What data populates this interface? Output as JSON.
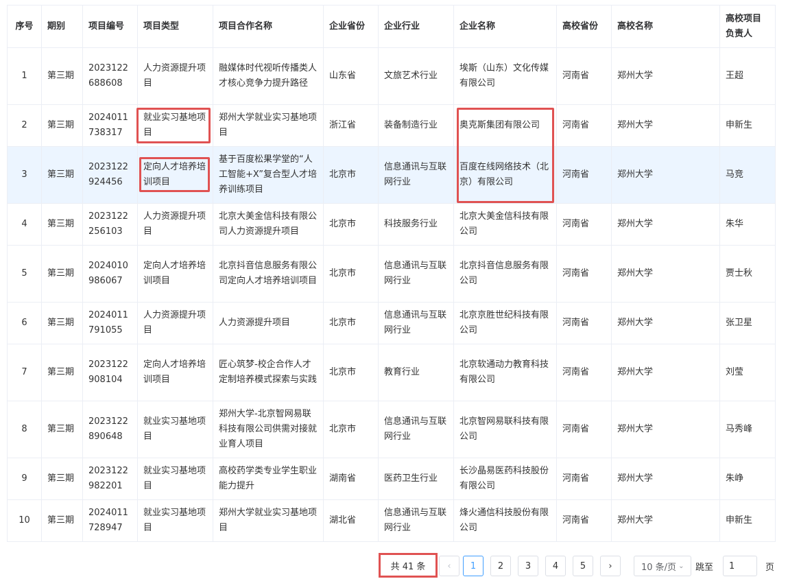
{
  "columns": [
    "序号",
    "期别",
    "项目编号",
    "项目类型",
    "项目合作名称",
    "企业省份",
    "企业行业",
    "企业名称",
    "高校省份",
    "高校名称",
    "高校项目负责人"
  ],
  "rows": [
    {
      "no": "1",
      "period": "第三期",
      "code": "2023122688608",
      "type": "人力资源提升项目",
      "name": "融媒体时代视听传播类人才核心竞争力提升路径",
      "prov": "山东省",
      "industry": "文旅艺术行业",
      "company": "埃斯（山东）文化传媒有限公司",
      "uprov": "河南省",
      "uni": "郑州大学",
      "lead": "王超"
    },
    {
      "no": "2",
      "period": "第三期",
      "code": "2024011738317",
      "type": "就业实习基地项目",
      "name": "郑州大学就业实习基地项目",
      "prov": "浙江省",
      "industry": "装备制造行业",
      "company": "奥克斯集团有限公司",
      "uprov": "河南省",
      "uni": "郑州大学",
      "lead": "申新生"
    },
    {
      "no": "3",
      "period": "第三期",
      "code": "2023122924456",
      "type": "定向人才培养培训项目",
      "name": "基于百度松果学堂的“人工智能+X”复合型人才培养训练项目",
      "prov": "北京市",
      "industry": "信息通讯与互联网行业",
      "company": "百度在线网络技术（北京）有限公司",
      "uprov": "河南省",
      "uni": "郑州大学",
      "lead": "马竞"
    },
    {
      "no": "4",
      "period": "第三期",
      "code": "2023122256103",
      "type": "人力资源提升项目",
      "name": "北京大美金信科技有限公司人力资源提升项目",
      "prov": "北京市",
      "industry": "科技服务行业",
      "company": "北京大美金信科技有限公司",
      "uprov": "河南省",
      "uni": "郑州大学",
      "lead": "朱华"
    },
    {
      "no": "5",
      "period": "第三期",
      "code": "2024010986067",
      "type": "定向人才培养培训项目",
      "name": "北京抖音信息服务有限公司定向人才培养培训项目",
      "prov": "北京市",
      "industry": "信息通讯与互联网行业",
      "company": "北京抖音信息服务有限公司",
      "uprov": "河南省",
      "uni": "郑州大学",
      "lead": "贾士秋"
    },
    {
      "no": "6",
      "period": "第三期",
      "code": "2024011791055",
      "type": "人力资源提升项目",
      "name": "人力资源提升项目",
      "prov": "北京市",
      "industry": "信息通讯与互联网行业",
      "company": "北京京胜世纪科技有限公司",
      "uprov": "河南省",
      "uni": "郑州大学",
      "lead": "张卫星"
    },
    {
      "no": "7",
      "period": "第三期",
      "code": "2023122908104",
      "type": "定向人才培养培训项目",
      "name": "匠心筑梦-校企合作人才定制培养模式探索与实践",
      "prov": "北京市",
      "industry": "教育行业",
      "company": "北京软通动力教育科技有限公司",
      "uprov": "河南省",
      "uni": "郑州大学",
      "lead": "刘莹"
    },
    {
      "no": "8",
      "period": "第三期",
      "code": "2023122890648",
      "type": "就业实习基地项目",
      "name": "郑州大学-北京智网易联科技有限公司供需对接就业育人项目",
      "prov": "北京市",
      "industry": "信息通讯与互联网行业",
      "company": "北京智网易联科技有限公司",
      "uprov": "河南省",
      "uni": "郑州大学",
      "lead": "马秀峰"
    },
    {
      "no": "9",
      "period": "第三期",
      "code": "2023122982201",
      "type": "就业实习基地项目",
      "name": "高校药学类专业学生职业能力提升",
      "prov": "湖南省",
      "industry": "医药卫生行业",
      "company": "长沙晶易医药科技股份有限公司",
      "uprov": "河南省",
      "uni": "郑州大学",
      "lead": "朱峥"
    },
    {
      "no": "10",
      "period": "第三期",
      "code": "2024011728947",
      "type": "就业实习基地项目",
      "name": "郑州大学就业实习基地项目",
      "prov": "湖北省",
      "industry": "信息通讯与互联网行业",
      "company": "烽火通信科技股份有限公司",
      "uprov": "河南省",
      "uni": "郑州大学",
      "lead": "申新生"
    }
  ],
  "pagination": {
    "total_text": "共 41 条",
    "prev_icon": "chevron-left-icon",
    "next_icon": "chevron-right-icon",
    "pages": [
      "1",
      "2",
      "3",
      "4",
      "5"
    ],
    "current_page": "1",
    "prev_label": "‹",
    "next_label": "›",
    "page_size_label": "10 条/页",
    "jump_label": "跳至",
    "jump_value": "1",
    "page_unit": "页"
  },
  "colors": {
    "highlight_row": "#ecf5ff",
    "annotation_red": "#e05252",
    "active_page": "#409eff"
  }
}
